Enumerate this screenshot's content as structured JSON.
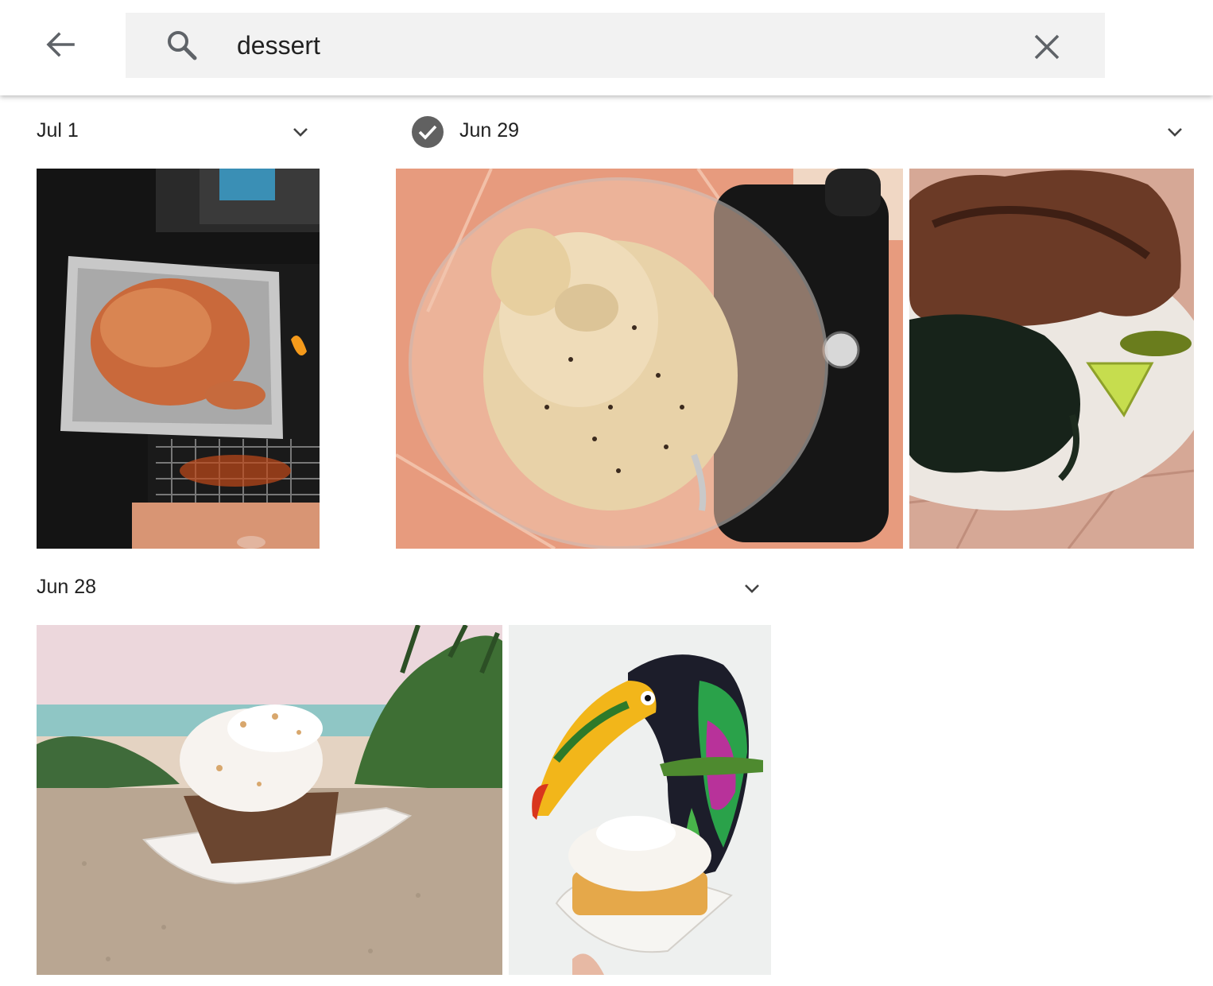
{
  "search": {
    "query": "dessert"
  },
  "groups": [
    {
      "date": "Jul 1"
    },
    {
      "date": "Jun 29",
      "selected": true
    },
    {
      "date": "Jun 28"
    }
  ],
  "icons": {
    "back": "arrow-back-icon",
    "search": "search-icon",
    "clear": "close-icon",
    "expand": "chevron-down-icon",
    "select": "check-circle-icon"
  },
  "colors": {
    "search_bg": "#f2f2f2",
    "icon": "#5f6368",
    "check": "#616161"
  }
}
